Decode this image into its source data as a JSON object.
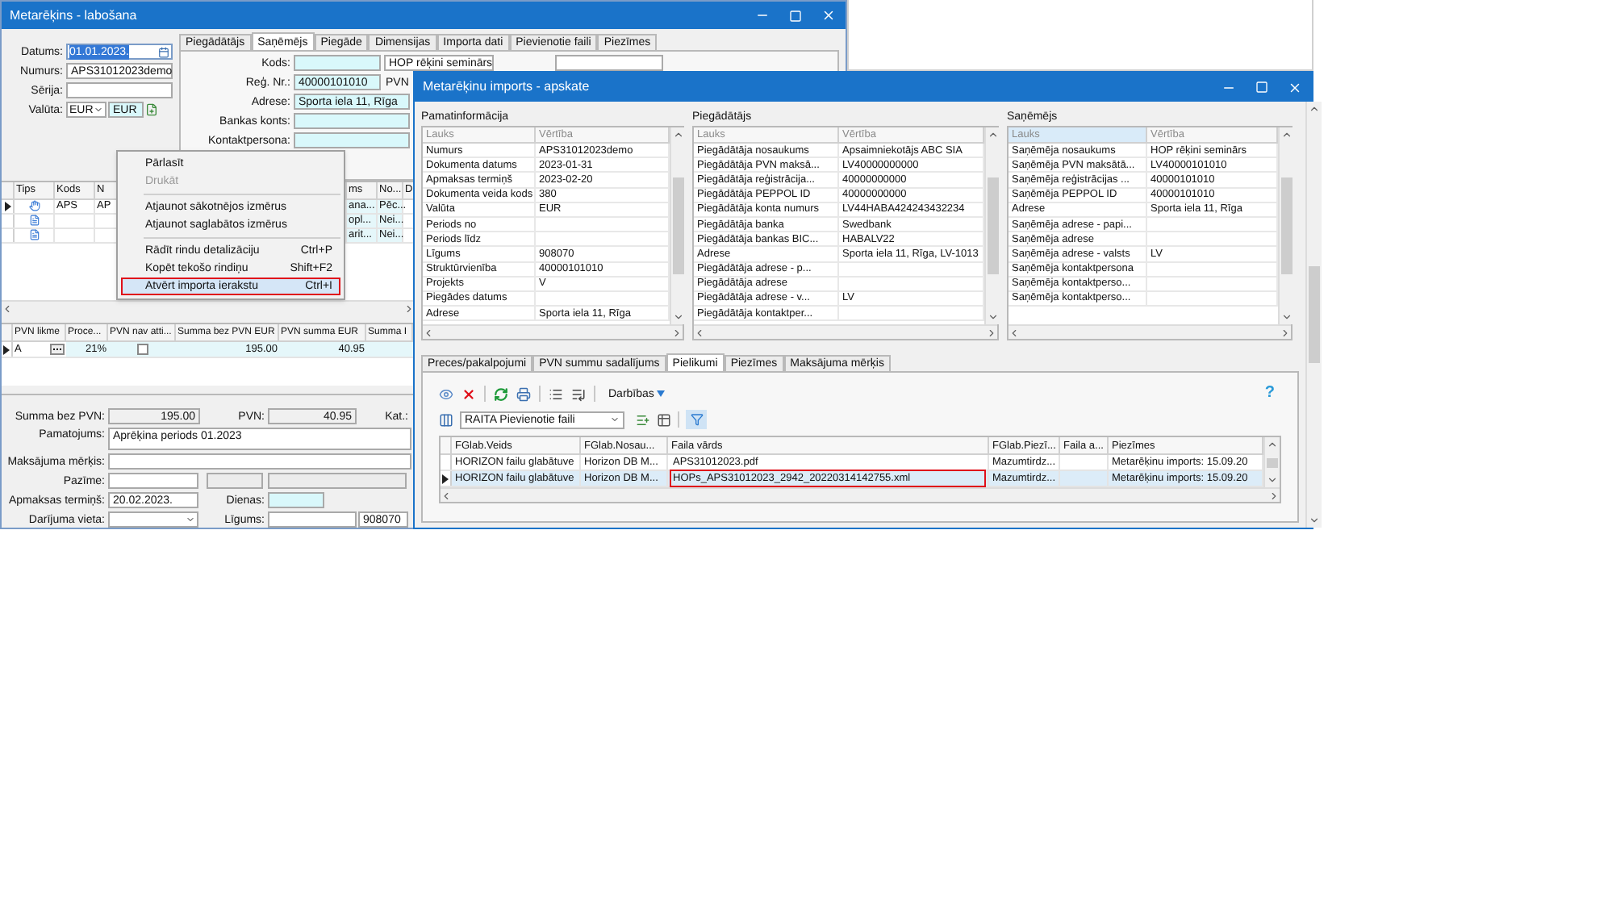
{
  "main_window": {
    "title": "Metarēķins - labošana",
    "header_fields": [
      {
        "label": "Datums:",
        "value": "01.01.2023.",
        "kind": "date",
        "highlighted": true
      },
      {
        "label": "Numurs:",
        "value": "APS31012023demo",
        "kind": "text"
      },
      {
        "label": "Sērija:",
        "kind": "text"
      },
      {
        "label": "Valūta:",
        "value": "EUR",
        "code": "EUR",
        "kind": "currency"
      }
    ],
    "tabs": [
      {
        "label": "Piegādātājs",
        "selected": false
      },
      {
        "label": "Saņēmējs",
        "selected": true
      },
      {
        "label": "Piegāde",
        "selected": false
      },
      {
        "label": "Dimensijas",
        "selected": false
      },
      {
        "label": "Importa dati",
        "selected": false
      },
      {
        "label": "Pievienotie faili",
        "selected": false
      },
      {
        "label": "Piezīmes",
        "selected": false
      }
    ],
    "party_fields": [
      {
        "label": "Kods:",
        "kind": "code",
        "name_value": "HOP rēķini seminārs"
      },
      {
        "label": "Reģ. Nr.:",
        "value": "40000101010",
        "kind": "reg",
        "side_label": "PVN"
      },
      {
        "label": "Adrese:",
        "value": "Sporta iela 11, Rīga",
        "kind": "cyan"
      },
      {
        "label": "Bankas konts:",
        "kind": "cyan"
      },
      {
        "label": "Kontaktpersona:",
        "kind": "cyan"
      }
    ],
    "items_grid": {
      "columns": [
        "Tips",
        "Kods",
        "N",
        "ms",
        "No...",
        "D"
      ],
      "rows": [
        {
          "kind": "pointer",
          "current": true,
          "cells": [
            "",
            "APS",
            "AP",
            "ana...",
            "Pēc...",
            ""
          ]
        },
        {
          "kind": "document",
          "current": false,
          "cells": [
            "",
            "",
            "",
            "opl...",
            "Nei...",
            ""
          ]
        },
        {
          "kind": "document",
          "current": false,
          "cells": [
            "",
            "",
            "",
            "arit...",
            "Nei...",
            ""
          ]
        }
      ]
    },
    "vat_grid": {
      "columns": [
        "PVN likme",
        "Proce...",
        "PVN nav atti...",
        "Summa bez PVN EUR",
        "PVN summa EUR",
        "Summa I"
      ],
      "rows": [
        {
          "current": true,
          "rate": "A",
          "percent": "21%",
          "exempt": false,
          "net": "195.00",
          "vat": "40.95"
        }
      ]
    },
    "totals": [
      {
        "label": "Summa bez PVN:",
        "value": "195.00"
      },
      {
        "label": "PVN:",
        "value": "40.95"
      },
      {
        "label": "Kat.:"
      }
    ],
    "details": [
      {
        "label": "Pamatojums:",
        "value": "Aprēķina periods 01.2023",
        "kind": "memo"
      },
      {
        "label": "Maksājuma mērķis:",
        "kind": "wide"
      },
      {
        "label": "Pazīme:",
        "kind": "flag"
      },
      {
        "label": "Apmaksas termiņš:",
        "value": "20.02.2023.",
        "kind": "due",
        "extra_label": "Dienas:"
      },
      {
        "label": "Darījuma vieta:",
        "kind": "place",
        "extra_label": "Līgums:",
        "extra_value": "908070"
      }
    ]
  },
  "context_menu": [
    {
      "kind": "item",
      "label": "Pārlasīt",
      "disabled": false,
      "selected": false
    },
    {
      "kind": "item",
      "label": "Drukāt",
      "disabled": true,
      "selected": false
    },
    {
      "kind": "separator"
    },
    {
      "kind": "item",
      "label": "Atjaunot sākotnējos izmērus",
      "disabled": false,
      "selected": false
    },
    {
      "kind": "item",
      "label": "Atjaunot saglabātos izmērus",
      "disabled": false,
      "selected": false
    },
    {
      "kind": "separator"
    },
    {
      "kind": "item",
      "label": "Rādīt rindu detalizāciju",
      "shortcut": "Ctrl+P",
      "disabled": false,
      "selected": false
    },
    {
      "kind": "item",
      "label": "Kopēt tekošo rindiņu",
      "shortcut": "Shift+F2",
      "disabled": false,
      "selected": false
    },
    {
      "kind": "item",
      "label": "Atvērt importa ierakstu",
      "shortcut": "Ctrl+I",
      "disabled": false,
      "selected": true,
      "outlined": true
    }
  ],
  "import_window": {
    "title": "Metarēķinu imports - apskate",
    "panels": [
      {
        "title": "Pamatinformācija",
        "columns": [
          {
            "label": "Lauks",
            "selected": false
          },
          {
            "label": "Vērtība",
            "selected": false
          }
        ],
        "rows": [
          [
            "Numurs",
            "APS31012023demo"
          ],
          [
            "Dokumenta datums",
            "2023-01-31"
          ],
          [
            "Apmaksas termiņš",
            "2023-02-20"
          ],
          [
            "Dokumenta veida kods",
            "380"
          ],
          [
            "Valūta",
            "EUR"
          ],
          [
            "Periods no",
            ""
          ],
          [
            "Periods līdz",
            ""
          ],
          [
            "Līgums",
            "908070"
          ],
          [
            "Struktūrvienība",
            "40000101010"
          ],
          [
            "Projekts",
            "V"
          ],
          [
            "Piegādes datums",
            ""
          ],
          [
            "Adrese",
            "Sporta iela 11, Rīga"
          ]
        ]
      },
      {
        "title": "Piegādātājs",
        "columns": [
          {
            "label": "Lauks",
            "selected": false
          },
          {
            "label": "Vērtība",
            "selected": false
          }
        ],
        "rows": [
          [
            "Piegādātāja nosaukums",
            "Apsaimniekotājs ABC SIA"
          ],
          [
            "Piegādātāja PVN maksā...",
            "LV40000000000"
          ],
          [
            "Piegādātāja reģistrācija...",
            "40000000000"
          ],
          [
            "Piegādātāja PEPPOL ID",
            "40000000000"
          ],
          [
            "Piegādātāja konta numurs",
            "LV44HABA424243432234"
          ],
          [
            "Piegādātāja banka",
            "Swedbank"
          ],
          [
            "Piegādātāja bankas BIC...",
            "HABALV22"
          ],
          [
            "Adrese",
            "Sporta iela 11, Rīga, LV-1013"
          ],
          [
            "Piegādātāja adrese - p...",
            ""
          ],
          [
            "Piegādātāja adrese",
            ""
          ],
          [
            "Piegādātāja adrese - v...",
            "LV"
          ],
          [
            "Piegādātāja kontaktper...",
            ""
          ]
        ]
      },
      {
        "title": "Saņēmējs",
        "columns": [
          {
            "label": "Lauks",
            "selected": true
          },
          {
            "label": "Vērtība",
            "selected": false
          }
        ],
        "rows": [
          [
            "Saņēmēja nosaukums",
            "HOP rēķini seminārs"
          ],
          [
            "Saņēmēja PVN maksātā...",
            "LV40000101010"
          ],
          [
            "Saņēmēja reģistrācijas ...",
            "40000101010"
          ],
          [
            "Saņēmēja PEPPOL ID",
            "40000101010"
          ],
          [
            "Adrese",
            "Sporta iela 11, Rīga"
          ],
          [
            "Saņēmēja adrese - papi...",
            ""
          ],
          [
            "Saņēmēja adrese",
            ""
          ],
          [
            "Saņēmēja adrese - valsts",
            "LV"
          ],
          [
            "Saņēmēja kontaktpersona",
            ""
          ],
          [
            "Saņēmēja kontaktperso...",
            ""
          ],
          [
            "Saņēmēja kontaktperso...",
            ""
          ]
        ]
      }
    ],
    "tabs": [
      {
        "label": "Preces/pakalpojumi",
        "selected": false
      },
      {
        "label": "PVN summu sadalījums",
        "selected": false
      },
      {
        "label": "Pielikumi",
        "selected": true
      },
      {
        "label": "Piezīmes",
        "selected": false
      },
      {
        "label": "Maksājuma mērķis",
        "selected": false
      }
    ],
    "actions_label": "Darbības",
    "help": "?",
    "view": "RAITA Pievienotie faili",
    "files_grid": {
      "columns": [
        "FGlab.Veids",
        "FGlab.Nosau...",
        "Faila vārds",
        "FGlab.Piezī...",
        "Faila a...",
        "Piezīmes"
      ],
      "rows": [
        {
          "selected": false,
          "current": false,
          "outlined": false,
          "cells": [
            "HORIZON failu glabātuve",
            "Horizon DB M...",
            "APS31012023.pdf",
            "Mazumtirdz...",
            "",
            "Metarēķinu imports: 15.09.20"
          ]
        },
        {
          "selected": true,
          "current": true,
          "outlined": true,
          "cells": [
            "HORIZON failu glabātuve",
            "Horizon DB M...",
            "HOPs_APS31012023_2942_20220314142755.xml",
            "Mazumtirdz...",
            "",
            "Metarēķinu imports: 15.09.20"
          ]
        }
      ]
    }
  }
}
